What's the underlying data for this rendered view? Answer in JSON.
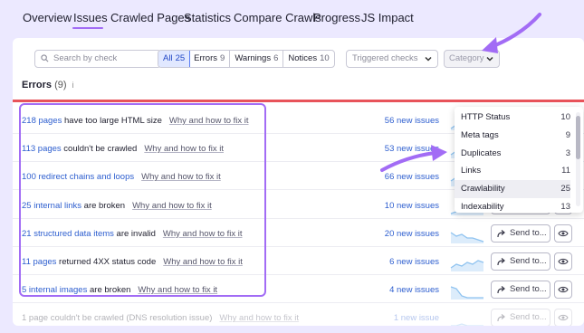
{
  "tabs": [
    {
      "label": "Overview"
    },
    {
      "label": "Issues"
    },
    {
      "label": "Crawled Pages"
    },
    {
      "label": "Statistics"
    },
    {
      "label": "Compare Crawls"
    },
    {
      "label": "Progress"
    },
    {
      "label": "JS Impact"
    }
  ],
  "active_tab": "Issues",
  "search": {
    "placeholder": "Search by check"
  },
  "filters": {
    "all": {
      "label": "All",
      "count": "25"
    },
    "errors": {
      "label": "Errors",
      "count": "9"
    },
    "warnings": {
      "label": "Warnings",
      "count": "6"
    },
    "notices": {
      "label": "Notices",
      "count": "10"
    }
  },
  "triggered": {
    "label": "Triggered checks"
  },
  "category": {
    "label": "Category"
  },
  "errors_header": {
    "title": "Errors",
    "count": "(9)",
    "info": "i"
  },
  "rows": [
    {
      "link": "218 pages",
      "text": " have too large HTML size",
      "why": "Why and how to fix it",
      "new": "56 new issues"
    },
    {
      "link": "113 pages",
      "text": " couldn't be crawled",
      "why": "Why and how to fix it",
      "new": "53 new issues"
    },
    {
      "link": "100 redirect chains and loops",
      "text": "",
      "why": "Why and how to fix it",
      "new": "66 new issues"
    },
    {
      "link": "25 internal links",
      "text": " are broken",
      "why": "Why and how to fix it",
      "new": "10 new issues"
    },
    {
      "link": "21 structured data items",
      "text": " are invalid",
      "why": "Why and how to fix it",
      "new": "20 new issues"
    },
    {
      "link": "11 pages",
      "text": " returned 4XX status code",
      "why": "Why and how to fix it",
      "new": "6 new issues"
    },
    {
      "link": "5 internal images",
      "text": " are broken",
      "why": "Why and how to fix it",
      "new": "4 new issues"
    },
    {
      "link": "",
      "text": "1 page couldn't be crawled (DNS resolution issue)",
      "why": "Why and how to fix it",
      "new": "1 new issue"
    }
  ],
  "send_label": "Send to...",
  "dropdown": [
    {
      "label": "HTTP Status",
      "count": "10"
    },
    {
      "label": "Meta tags",
      "count": "9"
    },
    {
      "label": "Duplicates",
      "count": "3"
    },
    {
      "label": "Links",
      "count": "11"
    },
    {
      "label": "Crawlability",
      "count": "25"
    },
    {
      "label": "Indexability",
      "count": "13"
    }
  ],
  "colors": {
    "accent": "#a26cf5",
    "link": "#2d5ecf",
    "error_line": "#e8535a",
    "spark": "#8fc3f0"
  },
  "icons": [
    "search-icon",
    "chevron-down-icon",
    "share-arrow-icon",
    "eye-icon",
    "info-icon"
  ]
}
